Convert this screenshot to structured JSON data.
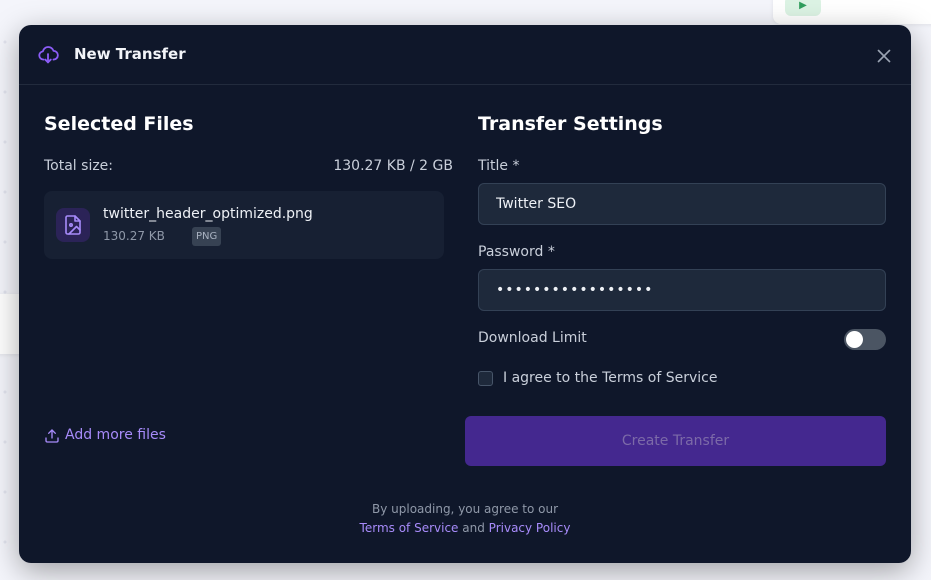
{
  "modal": {
    "title": "New Transfer",
    "icon": "cloud-download-icon",
    "close_icon": "close-icon"
  },
  "files": {
    "heading": "Selected Files",
    "total_label": "Total size:",
    "total_value": "130.27 KB / 2 GB",
    "items": [
      {
        "name": "twitter_header_optimized.png",
        "size": "130.27 KB",
        "type": "PNG",
        "icon": "image-file-icon"
      }
    ],
    "add_more_label": "Add more files",
    "add_more_icon": "upload-icon"
  },
  "settings": {
    "heading": "Transfer Settings",
    "title_label": "Title *",
    "title_value": "Twitter SEO",
    "password_label": "Password *",
    "password_value": "•••••••••••••••••",
    "download_limit_label": "Download Limit",
    "download_limit_enabled": false,
    "terms_label": "I agree to the Terms of Service",
    "terms_checked": false,
    "create_button_label": "Create Transfer"
  },
  "footer": {
    "line1": "By uploading, you agree to our",
    "terms_link": "Terms of Service",
    "and_text": "and",
    "privacy_link": "Privacy Policy"
  },
  "colors": {
    "modal_bg": "#0f172a",
    "accent": "#a78bfa",
    "button_bg": "#44288f"
  }
}
